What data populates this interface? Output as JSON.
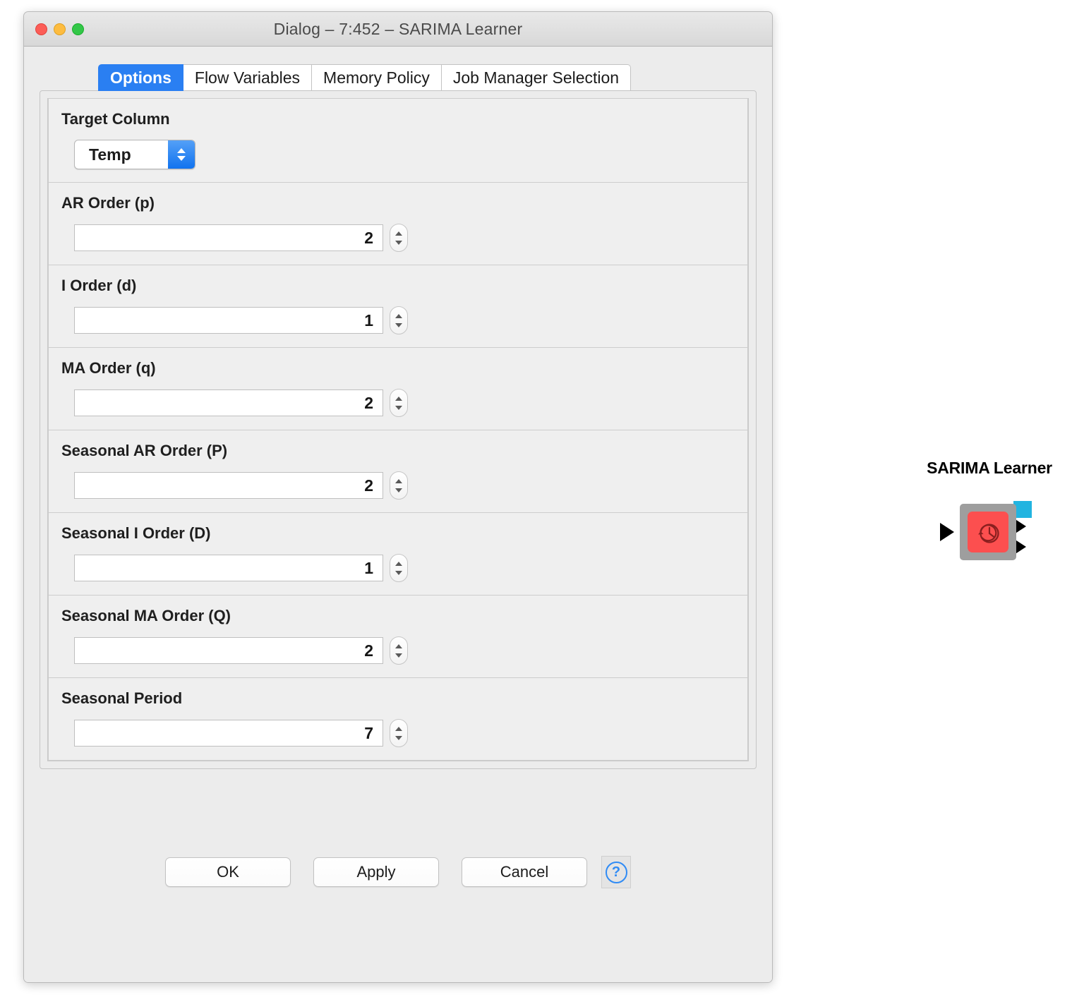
{
  "window": {
    "title": "Dialog – 7:452 – SARIMA Learner",
    "traffic_lights": [
      "close-red",
      "minimize-yellow",
      "zoom-green"
    ]
  },
  "tabs": [
    {
      "label": "Options",
      "active": true
    },
    {
      "label": "Flow Variables",
      "active": false
    },
    {
      "label": "Memory Policy",
      "active": false
    },
    {
      "label": "Job Manager Selection",
      "active": false
    }
  ],
  "groups": [
    {
      "label": "Target Column",
      "control": "combo",
      "value": "Temp"
    },
    {
      "label": "AR Order (p)",
      "control": "spinner",
      "value": "2"
    },
    {
      "label": "I Order (d)",
      "control": "spinner",
      "value": "1"
    },
    {
      "label": "MA Order (q)",
      "control": "spinner",
      "value": "2"
    },
    {
      "label": "Seasonal AR Order (P)",
      "control": "spinner",
      "value": "2"
    },
    {
      "label": "Seasonal I Order (D)",
      "control": "spinner",
      "value": "1"
    },
    {
      "label": "Seasonal MA Order (Q)",
      "control": "spinner",
      "value": "2"
    },
    {
      "label": "Seasonal Period",
      "control": "spinner",
      "value": "7"
    }
  ],
  "buttons": {
    "ok": "OK",
    "apply": "Apply",
    "cancel": "Cancel",
    "help": "?"
  },
  "node": {
    "title": "SARIMA Learner",
    "icon": "clock-history-icon",
    "colors": {
      "frame": "#9e9e9e",
      "body": "#fc4f4f",
      "flow_port": "#22b4e0",
      "accent_blue": "#2a7ff2"
    }
  }
}
